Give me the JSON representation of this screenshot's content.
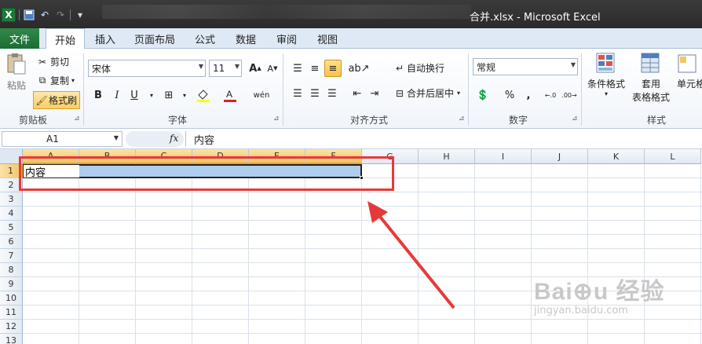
{
  "window": {
    "title": "合并.xlsx - Microsoft Excel",
    "file_name": "合并.xlsx",
    "app_name": "Microsoft Excel"
  },
  "tabs": [
    {
      "label": "文件"
    },
    {
      "label": "开始",
      "active": true
    },
    {
      "label": "插入"
    },
    {
      "label": "页面布局"
    },
    {
      "label": "公式"
    },
    {
      "label": "数据"
    },
    {
      "label": "审阅"
    },
    {
      "label": "视图"
    }
  ],
  "ribbon": {
    "clipboard": {
      "label": "剪贴板",
      "paste": "粘贴",
      "cut": "剪切",
      "copy": "复制",
      "format_painter": "格式刷"
    },
    "font": {
      "label": "字体",
      "font_name": "宋体",
      "font_size": "11",
      "bold": "B",
      "italic": "I",
      "underline": "U",
      "phonetic": "wén"
    },
    "alignment": {
      "label": "对齐方式",
      "wrap_text": "自动换行",
      "merge_center": "合并后居中"
    },
    "number": {
      "label": "数字",
      "format": "常规",
      "percent": "%",
      "comma": ","
    },
    "styles": {
      "label": "样式",
      "conditional": "条件格式",
      "table_style_1": "套用",
      "table_style_2": "表格格式",
      "cell_styles": "单元格"
    }
  },
  "formula_bar": {
    "name_box": "A1",
    "fx": "fx",
    "content": "内容"
  },
  "sheet": {
    "columns": [
      "A",
      "B",
      "C",
      "D",
      "E",
      "F",
      "G",
      "H",
      "I",
      "J",
      "K",
      "L"
    ],
    "rows": [
      "1",
      "2",
      "3",
      "4",
      "5",
      "6",
      "7",
      "8",
      "9",
      "10",
      "11",
      "12",
      "13"
    ],
    "cells": {
      "A1": "内容"
    },
    "selection": "A1:F1"
  },
  "watermark": {
    "brand": "Bai⊕u 经验",
    "url": "jingyan.baidu.com"
  },
  "colors": {
    "file_tab": "#1d6b35",
    "selection": "#aecdef",
    "highlight_box": "#e8393a",
    "header_selected": "#f2c567"
  }
}
